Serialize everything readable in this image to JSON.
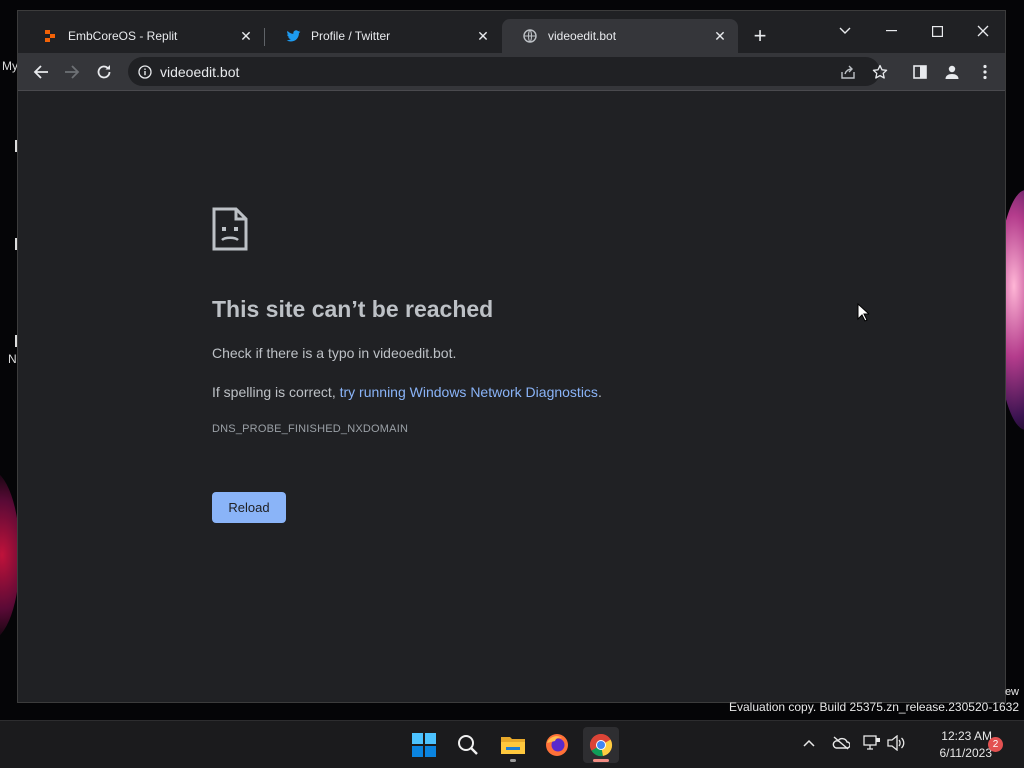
{
  "desktop": {
    "labels": [
      "My",
      "N"
    ],
    "watermark_suffix": "ew",
    "watermark": "Evaluation copy. Build 25375.zn_release.230520-1632"
  },
  "browser": {
    "tabs": [
      {
        "title": "EmbCoreOS - Replit",
        "icon": "replit-icon",
        "active": false
      },
      {
        "title": "Profile / Twitter",
        "icon": "twitter-icon",
        "active": false
      },
      {
        "title": "videoedit.bot",
        "icon": "globe-icon",
        "active": true
      }
    ],
    "address": "videoedit.bot",
    "accent": "#8ab4f8"
  },
  "error_page": {
    "title": "This site can’t be reached",
    "line1": "Check if there is a typo in videoedit.bot.",
    "line2_prefix": "If spelling is correct, ",
    "line2_link": "try running Windows Network Diagnostics",
    "line2_suffix": ".",
    "code": "DNS_PROBE_FINISHED_NXDOMAIN",
    "reload_label": "Reload"
  },
  "taskbar": {
    "apps": [
      "windows-start-icon",
      "search-icon",
      "file-explorer-icon",
      "firefox-icon",
      "chrome-icon"
    ],
    "time": "12:23 AM",
    "date": "6/11/2023",
    "notification_count": "2"
  }
}
